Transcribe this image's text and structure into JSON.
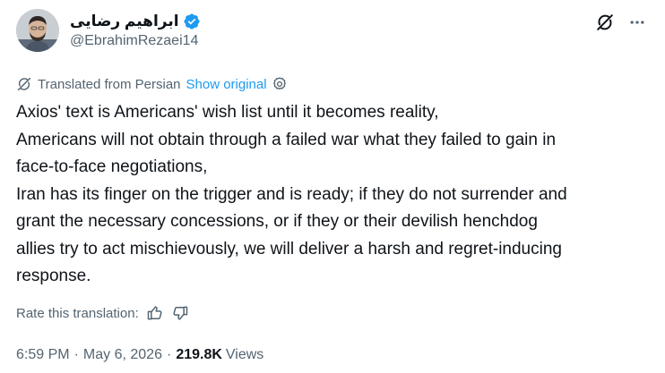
{
  "author": {
    "display_name": "ابراهیم رضایی",
    "handle": "@EbrahimRezaei14",
    "verified": true,
    "verified_color": "#1d9bf0"
  },
  "top_actions": {
    "grok_icon": "grok-slash-icon",
    "more_icon": "more-dots-icon"
  },
  "translation": {
    "label": "Translated from Persian",
    "show_original": "Show original",
    "settings_icon": "gear-icon"
  },
  "tweet": {
    "lines": [
      "Axios' text is Americans' wish list until it becomes reality,",
      "Americans will not obtain through a failed war what they failed to gain in",
      "face-to-face negotiations,",
      "Iran has its finger on the trigger and is ready; if they do not surrender and",
      "grant the necessary concessions, or if they or their devilish henchdog",
      "allies try to act mischievously, we will deliver a harsh and regret-inducing",
      "response."
    ]
  },
  "rate": {
    "label": "Rate this translation:",
    "up_icon": "thumbs-up-icon",
    "down_icon": "thumbs-down-icon"
  },
  "meta": {
    "time": "6:59 PM",
    "separator": "·",
    "date": "May 6, 2026",
    "views_count": "219.8K",
    "views_label": "Views"
  },
  "colors": {
    "text": "#0f1419",
    "secondary": "#536471",
    "link": "#1d9bf0"
  }
}
